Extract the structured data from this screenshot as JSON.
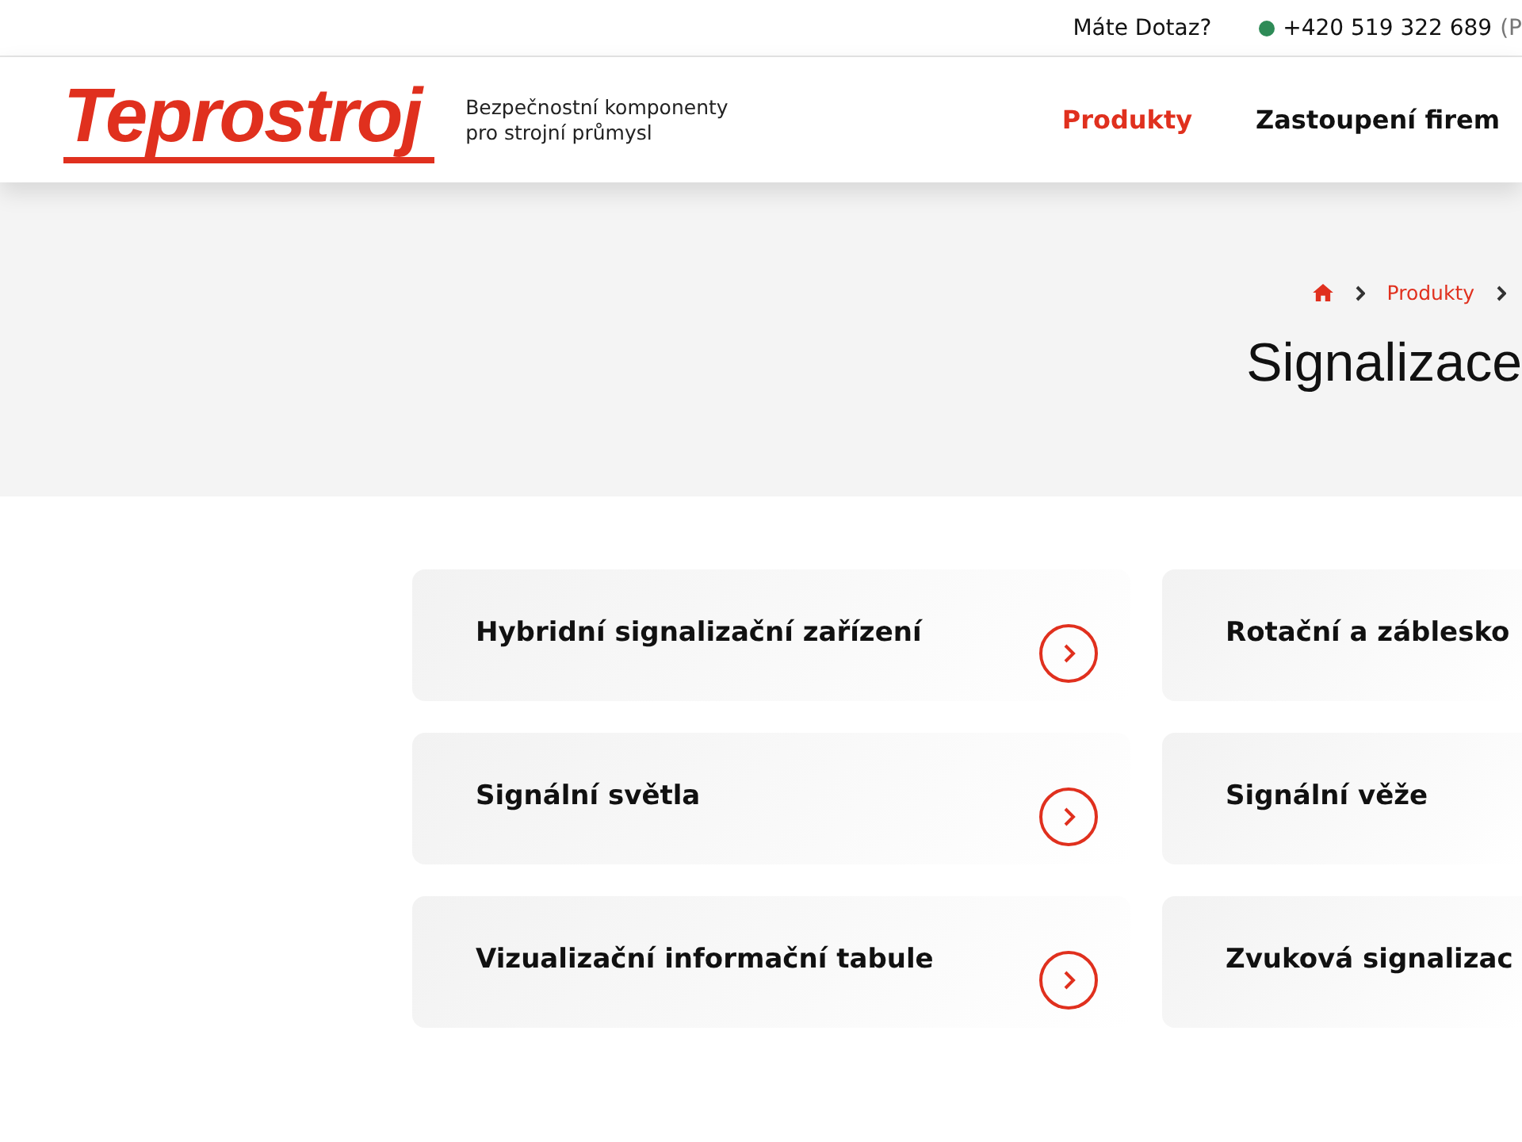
{
  "top_bar": {
    "question": "Máte Dotaz?",
    "phone": "+420 519 322 689",
    "phone_note": "(P"
  },
  "header": {
    "logo": "Teprostroj",
    "tagline": [
      "Bezpečnostní komponenty",
      "pro strojní průmysl"
    ],
    "nav": [
      {
        "label": "Produkty",
        "selected": true
      },
      {
        "label": "Zastoupení firem",
        "selected": false
      }
    ]
  },
  "breadcrumbs": [
    "Produkty"
  ],
  "page_title": "Signalizace",
  "categories": [
    {
      "label": "Hybridní signalizační zařízení",
      "arrow": true
    },
    {
      "label": "Rotační a záblesko",
      "arrow": false
    },
    {
      "label": "Signální světla",
      "arrow": true
    },
    {
      "label": "Signální věže",
      "arrow": false
    },
    {
      "label": "Vizualizační informační tabule",
      "arrow": true
    },
    {
      "label": "Zvuková signalizac",
      "arrow": false
    }
  ]
}
